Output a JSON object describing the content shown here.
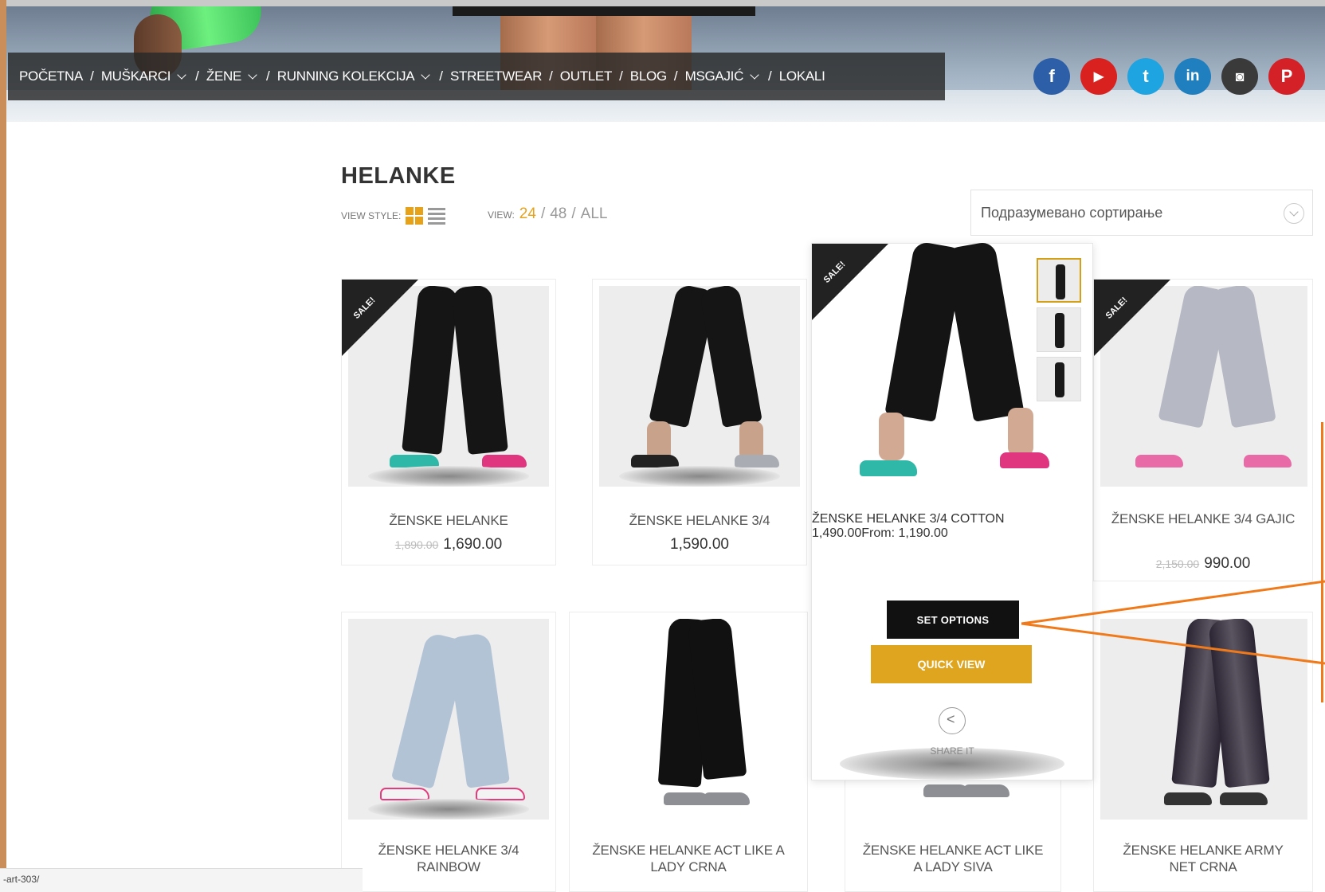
{
  "nav": {
    "items": [
      {
        "label": "POČETNA",
        "has_dropdown": false
      },
      {
        "label": "MUŠKARCI",
        "has_dropdown": true
      },
      {
        "label": "ŽENE",
        "has_dropdown": true
      },
      {
        "label": "RUNNING KOLEKCIJA",
        "has_dropdown": true
      },
      {
        "label": "STREETWEAR",
        "has_dropdown": false
      },
      {
        "label": "OUTLET",
        "has_dropdown": false
      },
      {
        "label": "BLOG",
        "has_dropdown": false
      },
      {
        "label": "MSGAJIĆ",
        "has_dropdown": true
      },
      {
        "label": "LOKALI",
        "has_dropdown": false
      }
    ],
    "separator": "/"
  },
  "social": [
    {
      "icon": "facebook-icon",
      "glyph": "f",
      "color": "#2d5fa8"
    },
    {
      "icon": "youtube-icon",
      "glyph": "▶",
      "color": "#d9211f"
    },
    {
      "icon": "twitter-icon",
      "glyph": "t",
      "color": "#1ea4e0"
    },
    {
      "icon": "linkedin-icon",
      "glyph": "in",
      "color": "#1f7fbf"
    },
    {
      "icon": "instagram-icon",
      "glyph": "◙",
      "color": "#3a3a3a"
    },
    {
      "icon": "pinterest-icon",
      "glyph": "P",
      "color": "#d42127"
    }
  ],
  "page": {
    "title": "HELANKE",
    "view_style_label": "VIEW STYLE:",
    "view_label": "VIEW:",
    "view_options": [
      "24",
      "48",
      "ALL"
    ],
    "view_active": "24",
    "sort_value": "Подразумевано сортирање"
  },
  "products": [
    {
      "name": "ŽENSKE HELANKE",
      "old_price": "1,890.00",
      "price": "1,690.00",
      "sale": true
    },
    {
      "name": "ŽENSKE HELANKE 3/4",
      "old_price": "",
      "price": "1,590.00",
      "sale": false
    },
    {
      "name": "ŽENSKE HELANKE 3/4 COTTON",
      "old_price": "1,490.00",
      "price": "From: 1,190.00",
      "sale": true
    },
    {
      "name": "ŽENSKE HELANKE 3/4 GAJIC",
      "old_price": "2,150.00",
      "price": "990.00",
      "sale": true
    },
    {
      "name": "ŽENSKE HELANKE 3/4 RAINBOW",
      "old_price": "",
      "price": "",
      "sale": false
    },
    {
      "name": "ŽENSKE HELANKE ACT LIKE A LADY CRNA",
      "old_price": "",
      "price": "",
      "sale": false
    },
    {
      "name": "ŽENSKE HELANKE ACT LIKE A LADY SIVA",
      "old_price": "",
      "price": "",
      "sale": false
    },
    {
      "name": "ŽENSKE HELANKE ARMY NET CRNA",
      "old_price": "",
      "price": "",
      "sale": false
    }
  ],
  "sale_badge": "SALE!",
  "hover": {
    "set_options": "SET OPTIONS",
    "quick_view": "QUICK VIEW",
    "share": "SHARE IT"
  },
  "status_url": "-art-303/",
  "colors": {
    "accent": "#e6a21b",
    "dark": "#111111",
    "annotation": "#f07a1a"
  }
}
